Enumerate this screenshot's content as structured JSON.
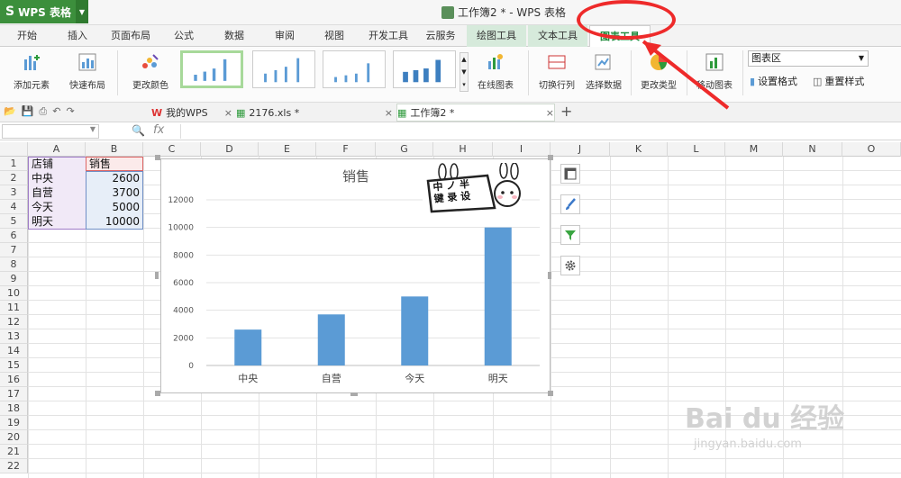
{
  "app": {
    "name": "WPS 表格",
    "title": "工作簿2 * - WPS 表格"
  },
  "menu_tabs": [
    {
      "label": "开始"
    },
    {
      "label": "插入"
    },
    {
      "label": "页面布局"
    },
    {
      "label": "公式"
    },
    {
      "label": "数据"
    },
    {
      "label": "审阅"
    },
    {
      "label": "视图"
    },
    {
      "label": "开发工具"
    },
    {
      "label": "云服务"
    },
    {
      "label": "绘图工具"
    },
    {
      "label": "文本工具"
    },
    {
      "label": "图表工具"
    }
  ],
  "ribbon": {
    "add_element": "添加元素",
    "quick_layout": "快速布局",
    "change_color": "更改颜色",
    "online_chart": "在线图表",
    "switch_rowcol": "切换行列",
    "select_data": "选择数据",
    "change_type": "更改类型",
    "move_chart": "移动图表",
    "chart_area_select": "图表区",
    "set_format": "设置格式",
    "reset_style": "重置样式"
  },
  "doc_tabs": [
    {
      "label": "我的WPS"
    },
    {
      "label": "2176.xls *"
    },
    {
      "label": "工作簿2 *"
    }
  ],
  "formula_bar": {
    "fx": "fx",
    "zoom_icon": "search-icon"
  },
  "columns": [
    "A",
    "B",
    "C",
    "D",
    "E",
    "F",
    "G",
    "H",
    "I",
    "J",
    "K",
    "L",
    "M",
    "N",
    "O"
  ],
  "rows": [
    "1",
    "2",
    "3",
    "4",
    "5",
    "6",
    "7",
    "8",
    "9",
    "10",
    "11",
    "12",
    "13",
    "14",
    "15",
    "16",
    "17",
    "18",
    "19",
    "20",
    "21",
    "22"
  ],
  "cells": {
    "A1": "店铺",
    "B1": "销售",
    "A2": "中央",
    "B2": "2600",
    "A3": "自营",
    "B3": "3700",
    "A4": "今天",
    "B4": "5000",
    "A5": "明天",
    "B5": "10000"
  },
  "sticker": {
    "line1": "中",
    "line2": "半",
    "line3": "键 录 设"
  },
  "watermark": {
    "main": "Bai du 经验",
    "sub": "jingyan.baidu.com"
  },
  "colors": {
    "bar": "#5b9bd5",
    "accent_green": "#1e8a3a",
    "annotation": "#ee2a2a"
  },
  "chart_data": {
    "type": "bar",
    "title": "销售",
    "categories": [
      "中央",
      "自营",
      "今天",
      "明天"
    ],
    "values": [
      2600,
      3700,
      5000,
      10000
    ],
    "ylim": [
      0,
      12000
    ],
    "yticks": [
      "0",
      "2000",
      "4000",
      "6000",
      "8000",
      "10000",
      "12000"
    ],
    "grid": true
  }
}
